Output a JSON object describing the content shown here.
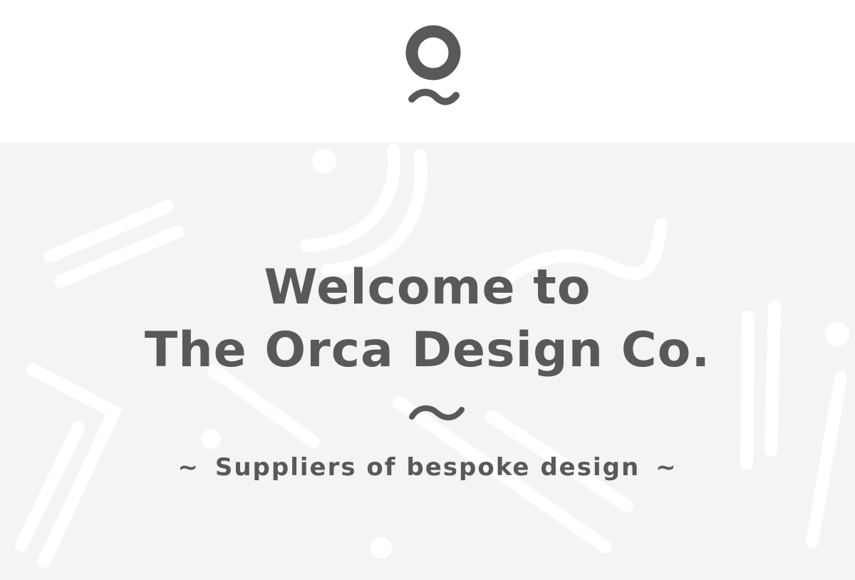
{
  "colors": {
    "text": "#58595b",
    "hero_background": "#f4f4f4",
    "header_background": "#ffffff",
    "decoration": "#ffffff"
  },
  "logo": {
    "icon": "orca-logo-icon"
  },
  "hero": {
    "title_line1": "Welcome to",
    "title_line2": "The Orca Design Co.",
    "divider_icon": "wave-tilde-icon",
    "tagline": {
      "left_mark": "~",
      "text": "Suppliers of bespoke design",
      "right_mark": "~"
    }
  }
}
